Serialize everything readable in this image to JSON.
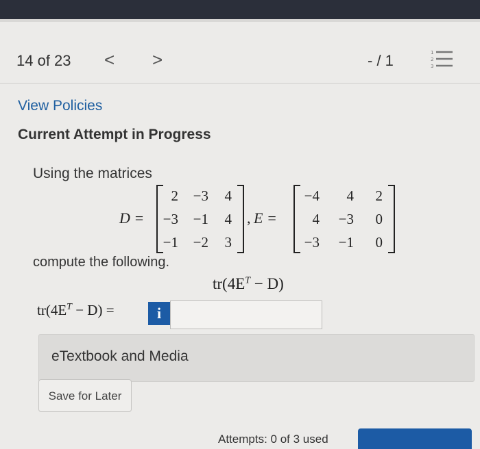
{
  "nav": {
    "position": "14 of 23",
    "prev_icon": "chevron-left-icon",
    "prev_glyph": "<",
    "next_icon": "chevron-right-icon",
    "next_glyph": ">",
    "score": "- / 1",
    "list_icon": "numbered-list-icon"
  },
  "links": {
    "view_policies": "View Policies"
  },
  "status": {
    "attempt": "Current Attempt in Progress"
  },
  "question": {
    "intro": "Using the matrices",
    "matrix_D": {
      "label": "D =",
      "rows": [
        [
          "2",
          "−3",
          "4"
        ],
        [
          "−3",
          "−1",
          "4"
        ],
        [
          "−1",
          "−2",
          "3"
        ]
      ]
    },
    "separator": ",",
    "matrix_E": {
      "label": "E =",
      "rows": [
        [
          "−4",
          "4",
          "2"
        ],
        [
          "4",
          "−3",
          "0"
        ],
        [
          "−3",
          "−1",
          "0"
        ]
      ]
    },
    "compute": "compute the following.",
    "expression_lhs": "tr(4E",
    "expression_sup": "T",
    "expression_rhs": " − D)",
    "answer_eq": " =",
    "info_label": "i",
    "answer_value": ""
  },
  "resources": {
    "etextbook": "eTextbook and Media"
  },
  "actions": {
    "save": "Save for Later",
    "attempts": "Attempts: 0 of 3 used"
  },
  "colors": {
    "link": "#1f5fa0",
    "primary": "#1c5ba5",
    "background": "#ecebe9"
  }
}
